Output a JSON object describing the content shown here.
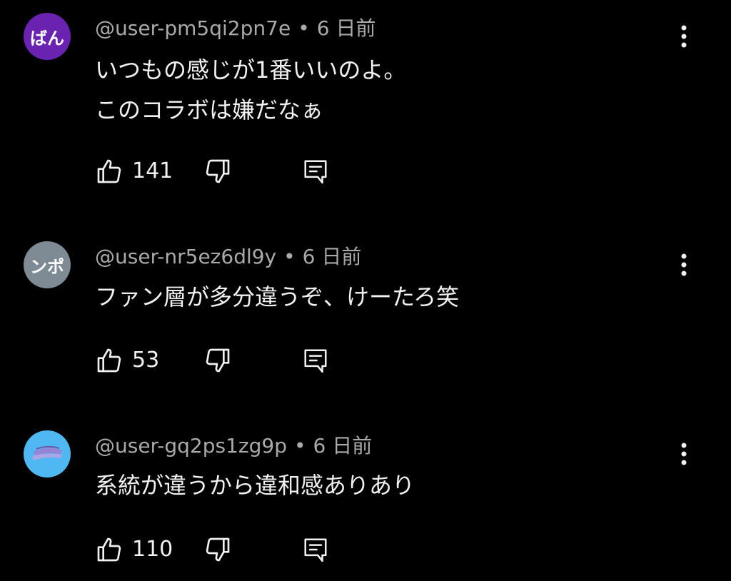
{
  "comments": [
    {
      "avatar_text": "ばん",
      "avatar_color": "#6a22b0",
      "username": "@user-pm5qi2pn7e",
      "separator": "•",
      "time": "6 日前",
      "lines": [
        "いつもの感じが1番いいのよ。",
        "このコラボは嫌だなぁ"
      ],
      "likes": "141"
    },
    {
      "avatar_text": "ンポ",
      "avatar_color": "#7e8a94",
      "username": "@user-nr5ez6dl9y",
      "separator": "•",
      "time": "6 日前",
      "lines": [
        "ファン層が多分違うぞ、けーたろ笑"
      ],
      "likes": "53"
    },
    {
      "avatar_text": "",
      "avatar_color": "#4fb8f2",
      "username": "@user-gq2ps1zg9p",
      "separator": "•",
      "time": "6 日前",
      "lines": [
        "系統が違うから違和感ありあり"
      ],
      "likes": "110"
    }
  ],
  "icons": {
    "like": "thumbs-up-icon",
    "dislike": "thumbs-down-icon",
    "reply": "reply-comment-icon",
    "menu": "more-vertical-icon"
  }
}
